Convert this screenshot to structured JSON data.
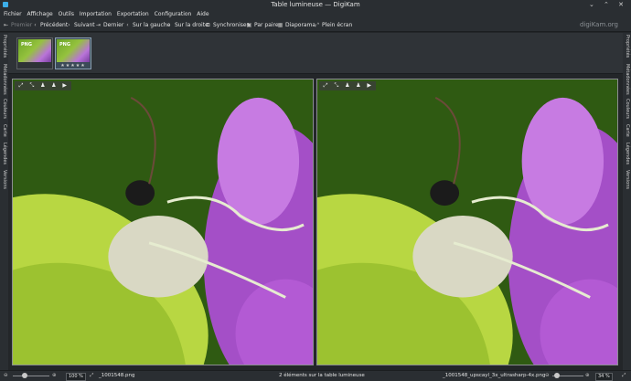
{
  "window": {
    "title": "Table lumineuse — DigiKam",
    "controls": "⌄ ⌃ ✕"
  },
  "menu": [
    "Fichier",
    "Affichage",
    "Outils",
    "Importation",
    "Exportation",
    "Configuration",
    "Aide"
  ],
  "toolbar": {
    "first": "Premier",
    "previous": "Précédent",
    "next": "Suivant",
    "last": "Dernier",
    "on_left": "Sur la gauche",
    "on_right": "Sur la droite",
    "sync": "Synchroniser",
    "by_pair": "Par paire",
    "slideshow": "Diaporama",
    "fullscreen": "Plein écran",
    "brand": "digiKam.org"
  },
  "left_tabs": [
    "Propriétés",
    "Métadonnées",
    "Couleurs",
    "Carte",
    "Légendes",
    "Versions"
  ],
  "right_tabs": [
    "Propriétés",
    "Métadonnées",
    "Couleurs",
    "Carte",
    "Légendes",
    "Versions"
  ],
  "thumbs": [
    {
      "label": "PNG",
      "stars": ""
    },
    {
      "label": "PNG",
      "stars": "★★★★★"
    }
  ],
  "pane_tools": [
    "⤢",
    "⤡",
    "♟",
    "♟",
    "▶"
  ],
  "status": {
    "left_zoom": "100 %",
    "left_file": "_1001548.png",
    "center": "2 éléments sur la table lumineuse",
    "right_file": "_1001548_upscayl_3x_ultrasharp-4x.png",
    "right_zoom": "34 %"
  },
  "colors": {
    "accent": "#3daee9",
    "background": "#232629",
    "bar": "#2a2e32"
  }
}
